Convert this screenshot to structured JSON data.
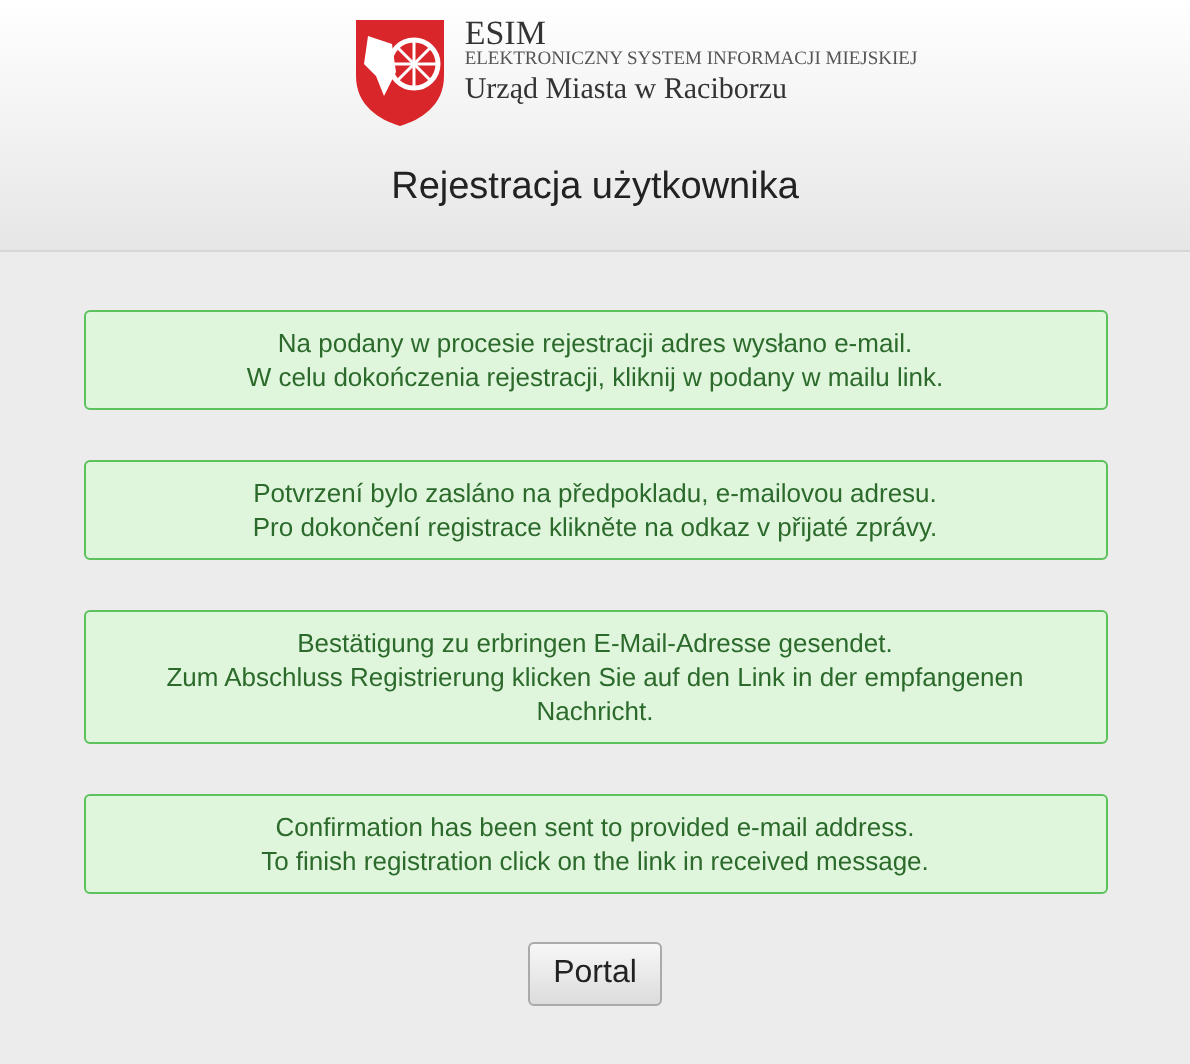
{
  "header": {
    "logo_title": "ESIM",
    "logo_subtitle": "ELEKTRONICZNY SYSTEM INFORMACJI MIEJSKIEJ",
    "logo_office": "Urząd Miasta w Raciborzu",
    "title": "Rejestracja użytkownika"
  },
  "messages": [
    {
      "lines": [
        "Na podany w procesie rejestracji adres wysłano e-mail.",
        "W celu dokończenia rejestracji, kliknij w podany w mailu link."
      ]
    },
    {
      "lines": [
        "Potvrzení bylo zasláno na předpokladu, e-mailovou adresu.",
        "Pro dokončení registrace klikněte na odkaz v přijaté zprávy."
      ]
    },
    {
      "lines": [
        "Bestätigung zu erbringen E-Mail-Adresse gesendet.",
        "Zum Abschluss Registrierung klicken Sie auf den Link in der empfangenen Nachricht."
      ]
    },
    {
      "lines": [
        "Confirmation has been sent to provided e-mail address.",
        "To finish registration click on the link in received message."
      ]
    }
  ],
  "buttons": [
    "Portal"
  ]
}
